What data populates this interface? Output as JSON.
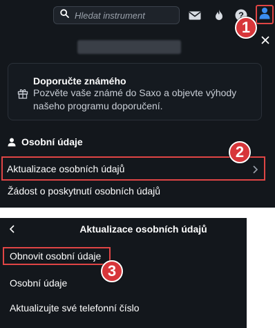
{
  "topbar": {
    "search_placeholder": "Hledat instrument",
    "icons": [
      "search-icon",
      "mail-icon",
      "flame-icon",
      "help-icon",
      "user-icon"
    ]
  },
  "referral": {
    "title": "Doporučte známého",
    "text": "Pozvěte vaše známé do Saxo a objevte výhody našeho programu doporučení."
  },
  "section": {
    "title": "Osobní údaje"
  },
  "menu": {
    "items": [
      {
        "label": "Aktualizace osobních údajů"
      },
      {
        "label": "Žádost o poskytnutí osobních údajů"
      }
    ]
  },
  "submenu": {
    "title": "Aktualizace osobních údajů",
    "items": [
      {
        "label": "Obnovit osobní údaje"
      },
      {
        "label": "Osobní údaje"
      },
      {
        "label": "Aktualizujte své telefonní číslo"
      }
    ]
  },
  "badges": [
    "1",
    "2",
    "3"
  ],
  "colors": {
    "panel_bg": "#13171c",
    "highlight": "#e04545",
    "badge": "#d7363a",
    "accent_user": "#3b8df0"
  }
}
